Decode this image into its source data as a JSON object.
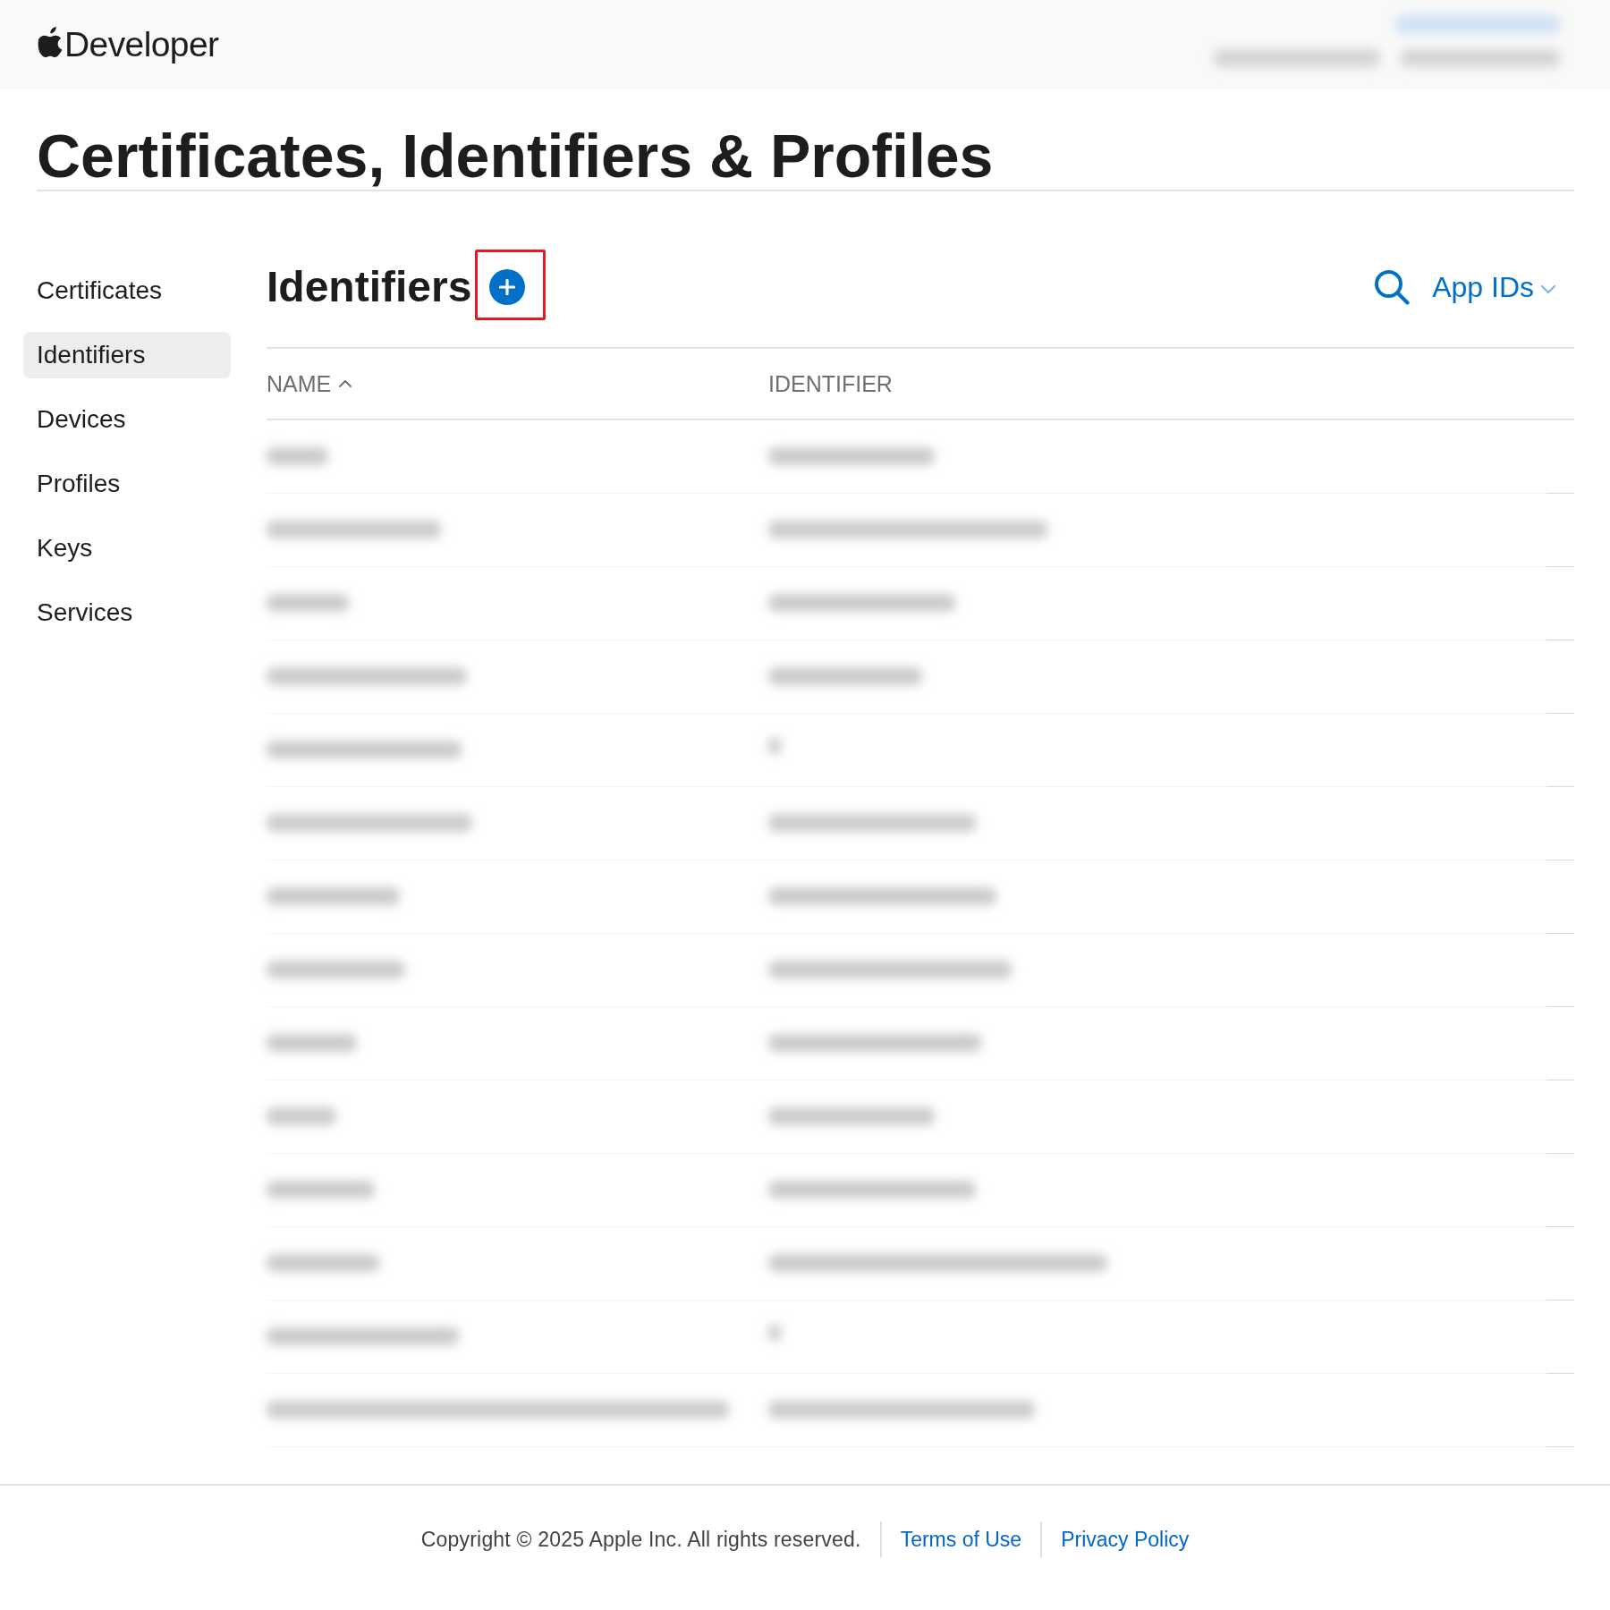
{
  "header": {
    "logo_text": "Developer",
    "account_blurred": true
  },
  "page_title": "Certificates, Identifiers & Profiles",
  "sidebar": {
    "items": [
      {
        "label": "Certificates",
        "selected": false
      },
      {
        "label": "Identifiers",
        "selected": true
      },
      {
        "label": "Devices",
        "selected": false
      },
      {
        "label": "Profiles",
        "selected": false
      },
      {
        "label": "Keys",
        "selected": false
      },
      {
        "label": "Services",
        "selected": false
      }
    ]
  },
  "section": {
    "title": "Identifiers",
    "add_button": {
      "highlighted": true
    },
    "filter": {
      "label": "App IDs"
    }
  },
  "table": {
    "columns": [
      {
        "label": "NAME",
        "sorted_ascending": true
      },
      {
        "label": "IDENTIFIER"
      }
    ],
    "rows": [
      {
        "blurred": true
      },
      {
        "blurred": true
      },
      {
        "blurred": true
      },
      {
        "blurred": true
      },
      {
        "blurred": true
      },
      {
        "blurred": true
      },
      {
        "blurred": true
      },
      {
        "blurred": true
      },
      {
        "blurred": true
      },
      {
        "blurred": true
      },
      {
        "blurred": true
      },
      {
        "blurred": true
      },
      {
        "blurred": true
      },
      {
        "blurred": true
      }
    ]
  },
  "footer": {
    "copyright": "Copyright © 2025 Apple Inc. All rights reserved.",
    "links": [
      "Terms of Use",
      "Privacy Policy"
    ]
  }
}
